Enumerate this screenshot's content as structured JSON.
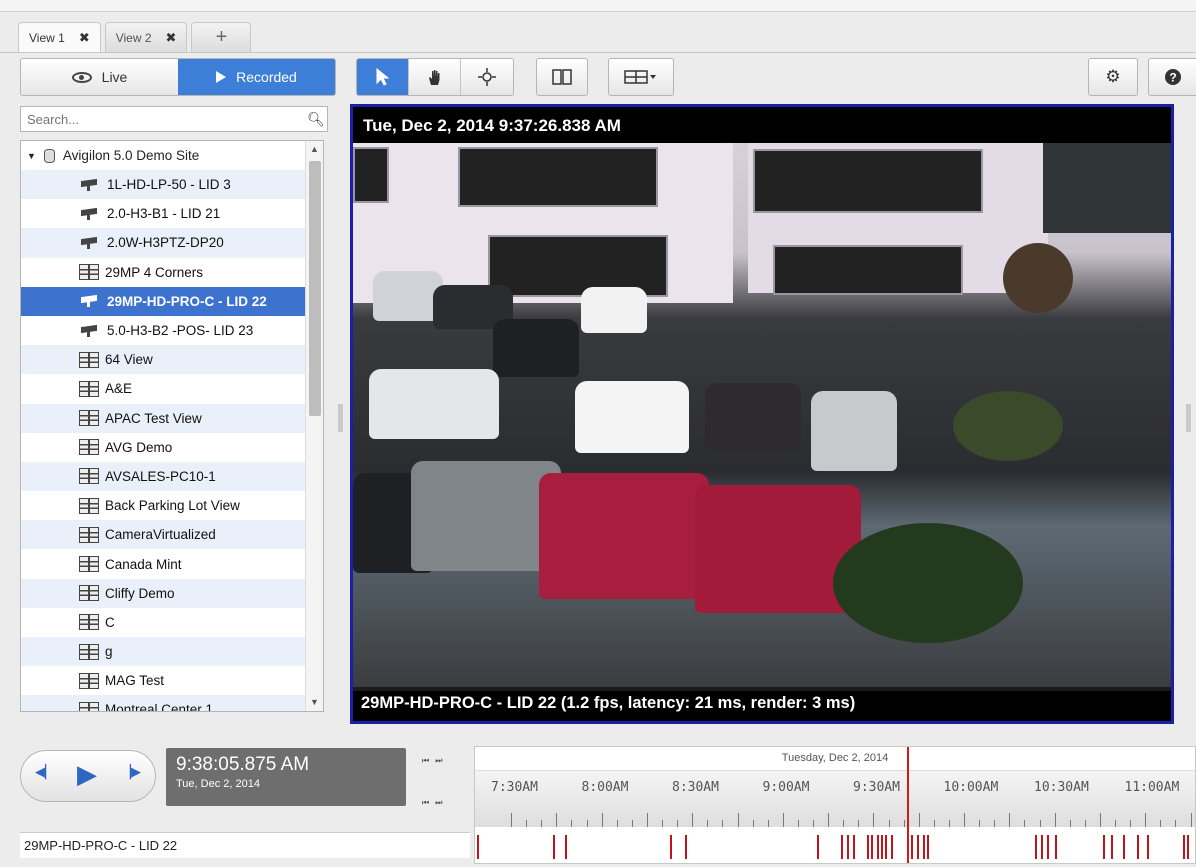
{
  "tabs": [
    {
      "label": "View 1",
      "close": "✖"
    },
    {
      "label": "View 2",
      "close": "✖"
    },
    {
      "label": "+"
    }
  ],
  "mode": {
    "live": "Live",
    "recorded": "Recorded",
    "active": "recorded"
  },
  "toolbar": {
    "select_icon": "arrow-pointer-icon",
    "pan_icon": "hand-icon",
    "ptz_icon": "crosshair-icon",
    "map_icon": "book-map-icon",
    "layout_icon": "layout-grid-dropdown-icon",
    "settings_icon": "gear-icon",
    "help_icon": "question-icon"
  },
  "search": {
    "placeholder": "Search..."
  },
  "tree": {
    "root": "Avigilon 5.0 Demo Site",
    "items": [
      {
        "label": "1L-HD-LP-50 - LID 3",
        "type": "camera"
      },
      {
        "label": "2.0-H3-B1 - LID 21",
        "type": "camera"
      },
      {
        "label": "2.0W-H3PTZ-DP20",
        "type": "camera"
      },
      {
        "label": "29MP 4 Corners",
        "type": "view"
      },
      {
        "label": "29MP-HD-PRO-C - LID 22",
        "type": "camera",
        "selected": true
      },
      {
        "label": "5.0-H3-B2 -POS- LID 23",
        "type": "camera"
      },
      {
        "label": "64 View",
        "type": "view"
      },
      {
        "label": "A&E",
        "type": "view"
      },
      {
        "label": "APAC Test View",
        "type": "view"
      },
      {
        "label": "AVG Demo",
        "type": "view"
      },
      {
        "label": "AVSALES-PC10-1",
        "type": "view"
      },
      {
        "label": "Back Parking Lot View",
        "type": "view"
      },
      {
        "label": "CameraVirtualized",
        "type": "view"
      },
      {
        "label": "Canada Mint",
        "type": "view"
      },
      {
        "label": "Cliffy Demo",
        "type": "view"
      },
      {
        "label": "C",
        "type": "view"
      },
      {
        "label": "g",
        "type": "view"
      },
      {
        "label": "MAG Test",
        "type": "view"
      },
      {
        "label": "Montreal Center 1",
        "type": "view"
      }
    ]
  },
  "video": {
    "timestamp": "Tue, Dec 2, 2014 9:37:26.838 AM",
    "caption": "29MP-HD-PRO-C - LID 22 (1.2 fps, latency: 21 ms, render: 3 ms)"
  },
  "playback": {
    "time": "9:38:05.875 AM",
    "date": "Tue, Dec 2, 2014"
  },
  "timeline": {
    "date_header": "Tuesday, Dec 2, 2014",
    "labels": [
      "7:30AM",
      "8:00AM",
      "8:30AM",
      "9:00AM",
      "9:30AM",
      "10:00AM",
      "10:30AM",
      "11:00AM"
    ],
    "cursor_time": "9:38:05.875 AM"
  },
  "status_bar": {
    "camera": "29MP-HD-PRO-C - LID 22"
  },
  "colors": {
    "accent": "#3d7fd8",
    "video_border": "#1a1fa8",
    "recording": "#c2151b"
  }
}
